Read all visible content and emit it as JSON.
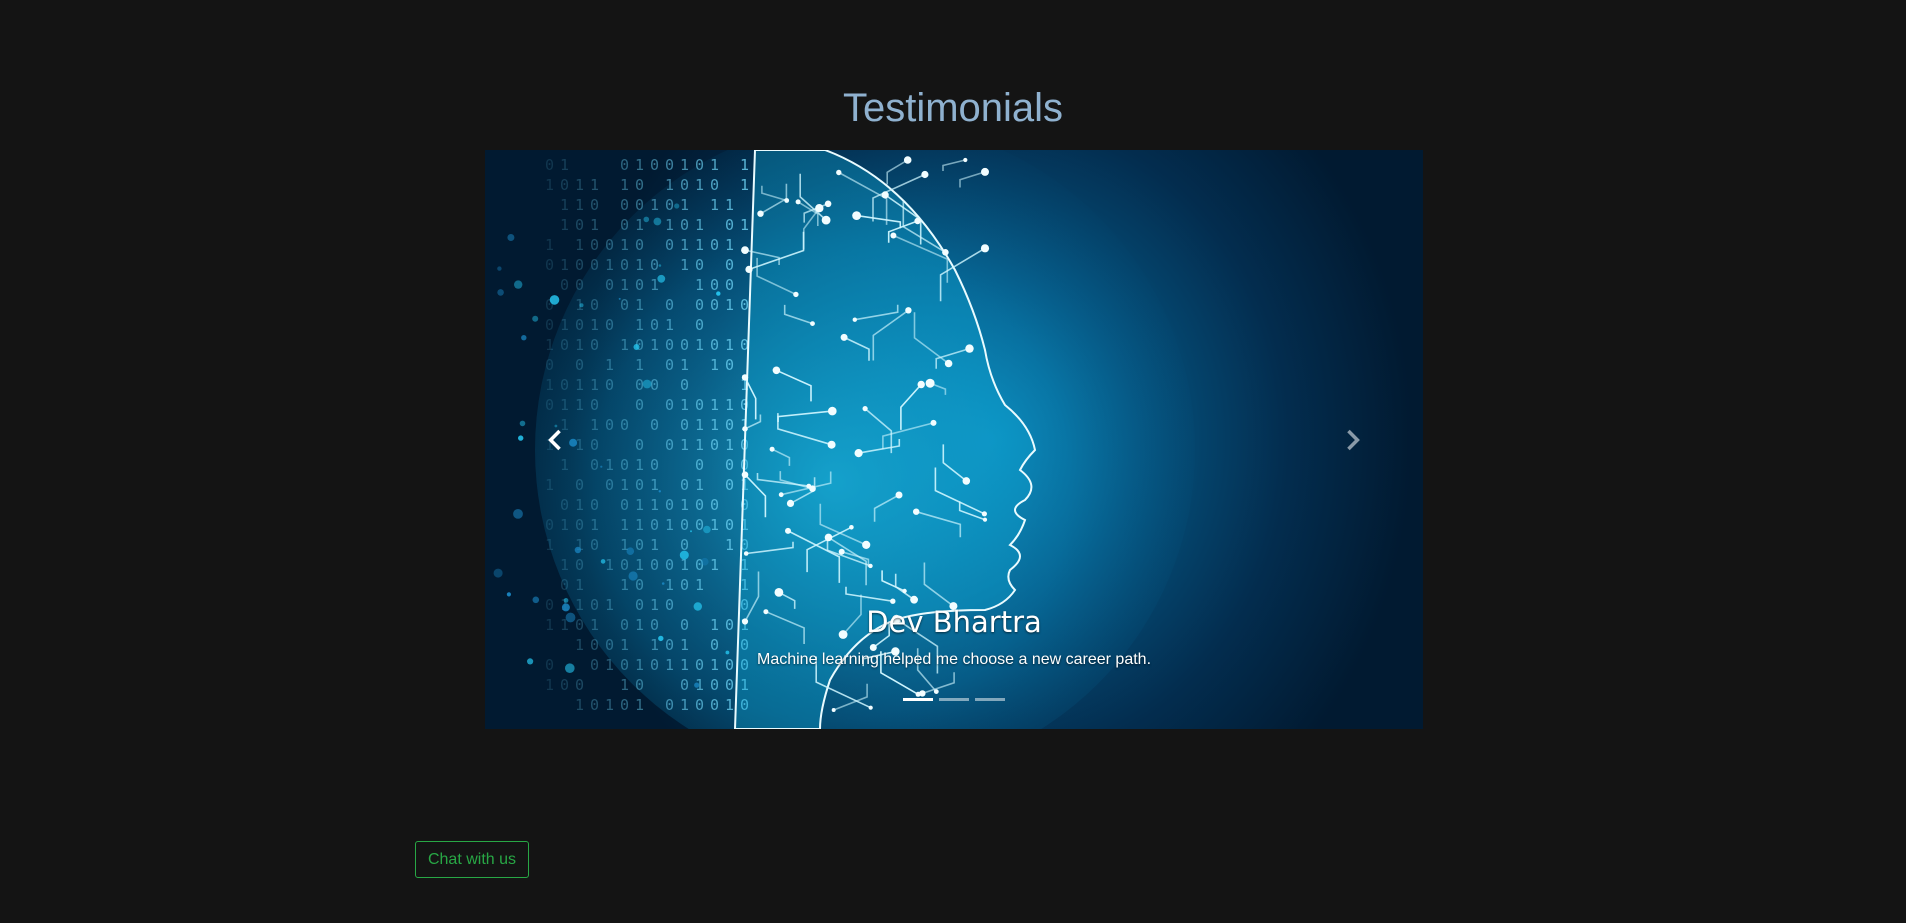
{
  "section": {
    "title": "Testimonials"
  },
  "carousel": {
    "slide": {
      "image": "ai-circuit-head-illustration",
      "binary_text": "0101101001",
      "name": "Dev Bhartra",
      "quote": "Machine learning helped me choose a new career path."
    },
    "controls": {
      "prev_icon": "chevron-left-icon",
      "next_icon": "chevron-right-icon"
    },
    "indicators": {
      "count": 3,
      "active_index": 0
    }
  },
  "chat": {
    "label": "Chat with us",
    "color": "#28a745"
  },
  "colors": {
    "background": "#141414",
    "title": "#8fb1cf",
    "slide_glow": "#0a7fb0",
    "circuit": "#bff3ff"
  }
}
